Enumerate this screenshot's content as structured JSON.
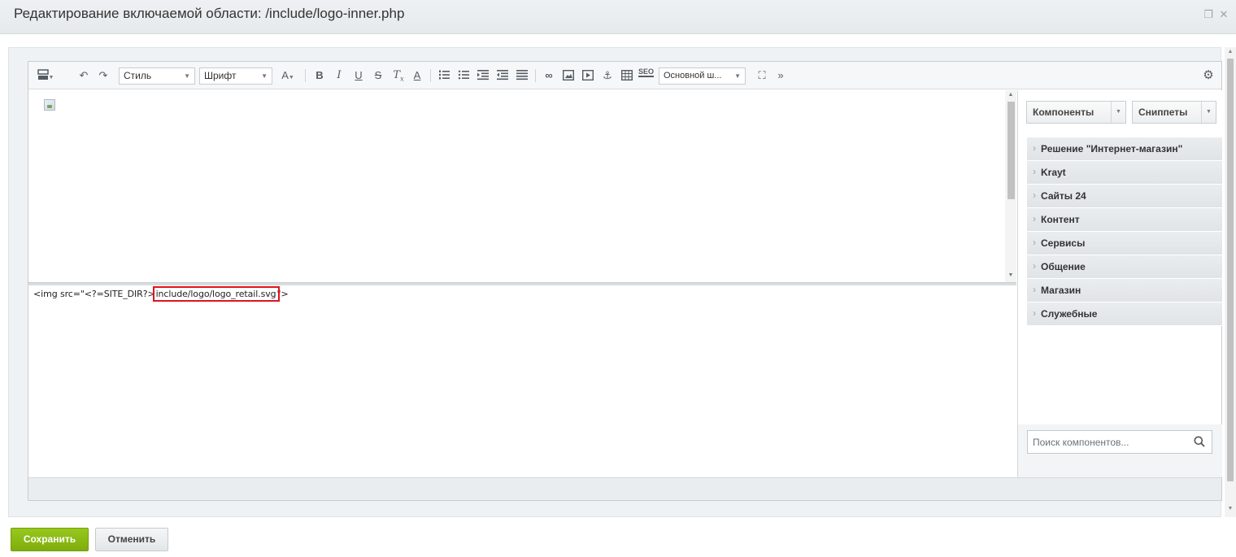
{
  "window": {
    "title": "Редактирование включаемой области: /include/logo-inner.php",
    "restore_icon": "restore-icon",
    "close_icon": "close-icon"
  },
  "toolbar": {
    "style_select": {
      "value": "Стиль"
    },
    "font_select": {
      "value": "Шрифт"
    },
    "font_size_label": "A",
    "bold": "B",
    "italic": "I",
    "underline": "U",
    "strike": "S",
    "clear_format": "T",
    "text_color": "A",
    "seo_label": "SEO",
    "template_select": {
      "value": "Основной ш..."
    },
    "more_label": "»"
  },
  "code": {
    "before": "<img src=\"<?=SITE_DIR?>",
    "highlight": "include/logo/logo_retail.svg",
    "after": "\">"
  },
  "side": {
    "components_label": "Компоненты",
    "snippets_label": "Сниппеты",
    "categories": [
      "Решение \"Интернет-магазин\"",
      "Krayt",
      "Сайты 24",
      "Контент",
      "Сервисы",
      "Общение",
      "Магазин",
      "Служебные"
    ],
    "search": {
      "placeholder": "Поиск компонентов...",
      "value": ""
    }
  },
  "footer": {
    "save_label": "Сохранить",
    "cancel_label": "Отменить"
  },
  "colors": {
    "save_button": "#8bbb14",
    "highlight_border": "#e0131a",
    "category_bg": "#e4e8ea"
  }
}
